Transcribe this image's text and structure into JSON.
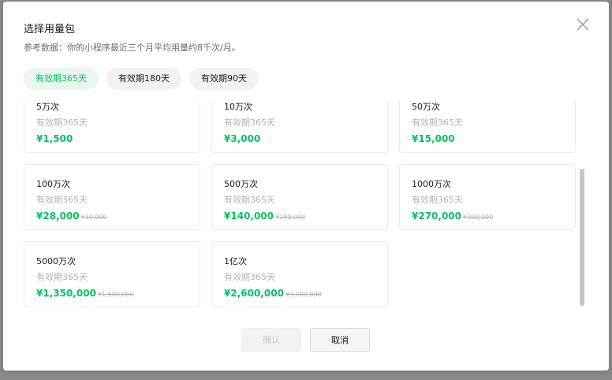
{
  "dialog": {
    "title": "选择用量包",
    "description": "参考数据：你的小程序最近三个月平均用量约8千次/月。",
    "close_icon": "close-icon"
  },
  "tabs": [
    {
      "label": "有效期365天",
      "active": true
    },
    {
      "label": "有效期180天",
      "active": false
    },
    {
      "label": "有效期90天",
      "active": false
    }
  ],
  "packages": [
    {
      "name": "5万次",
      "validity": "有效期365天",
      "price": "¥1,500",
      "original": ""
    },
    {
      "name": "10万次",
      "validity": "有效期365天",
      "price": "¥3,000",
      "original": ""
    },
    {
      "name": "50万次",
      "validity": "有效期365天",
      "price": "¥15,000",
      "original": ""
    },
    {
      "name": "100万次",
      "validity": "有效期365天",
      "price": "¥28,000",
      "original": "¥30,000"
    },
    {
      "name": "500万次",
      "validity": "有效期365天",
      "price": "¥140,000",
      "original": "¥150,000"
    },
    {
      "name": "1000万次",
      "validity": "有效期365天",
      "price": "¥270,000",
      "original": "¥300,000"
    },
    {
      "name": "5000万次",
      "validity": "有效期365天",
      "price": "¥1,350,000",
      "original": "¥1,500,000"
    },
    {
      "name": "1亿次",
      "validity": "有效期365天",
      "price": "¥2,600,000",
      "original": "¥3,000,000"
    }
  ],
  "buttons": {
    "confirm": "确认",
    "cancel": "取消"
  },
  "colors": {
    "accent": "#07c160",
    "active_tab_bg": "#e9f7ef"
  }
}
